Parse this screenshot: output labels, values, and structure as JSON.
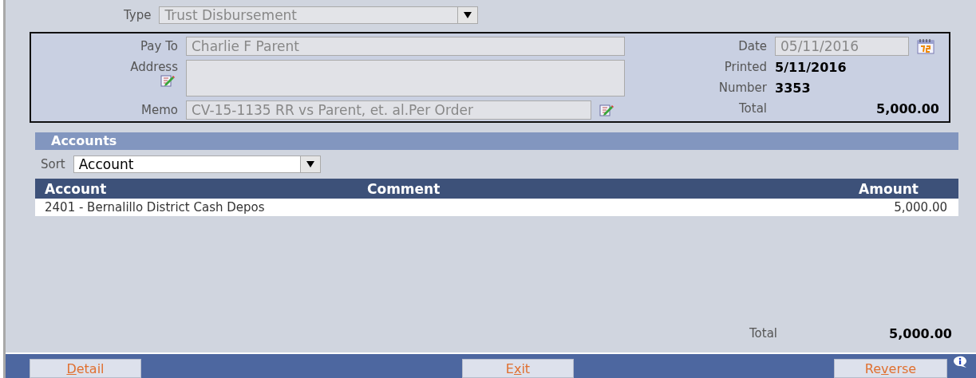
{
  "type_field": {
    "label": "Type",
    "value": "Trust Disbursement",
    "disabled": true
  },
  "payee": {
    "pay_to_label": "Pay To",
    "pay_to": "Charlie F Parent",
    "address_label": "Address",
    "memo_label": "Memo",
    "memo": "CV-15-1135 RR vs Parent, et. al.Per Order",
    "date_label": "Date",
    "date": "05/11/2016",
    "printed_label": "Printed",
    "printed": "5/11/2016",
    "number_label": "Number",
    "number": "3353",
    "total_label": "Total",
    "total": "5,000.00"
  },
  "accounts": {
    "title": "Accounts",
    "sort_label": "Sort",
    "sort_value": "Account",
    "columns": [
      "Account",
      "Comment",
      "Amount"
    ],
    "rows": [
      {
        "account": "2401 - Bernalillo District Cash Depos",
        "amount": "5,000.00"
      }
    ],
    "total_label": "Total",
    "total": "5,000.00"
  },
  "buttons": [
    {
      "key": "D",
      "post": "etail"
    },
    {
      "pre": "E",
      "key": "x",
      "post": "it"
    },
    {
      "pre": "Re",
      "key": "v",
      "post": "erse"
    }
  ]
}
